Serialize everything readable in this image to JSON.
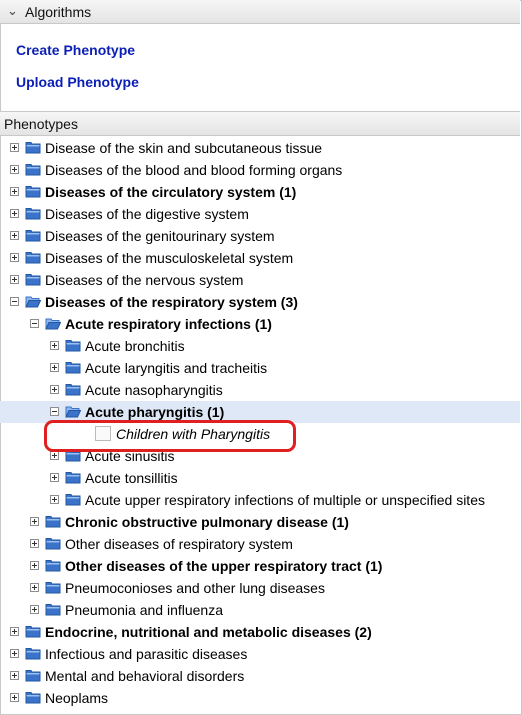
{
  "algorithms": {
    "title": "Algorithms",
    "links": [
      "Create Phenotype",
      "Upload Phenotype"
    ]
  },
  "phenotypes": {
    "title": "Phenotypes",
    "nodes": [
      {
        "label": "Disease of the skin and subcutaneous tissue",
        "level": 0,
        "state": "collapsed",
        "bold": false,
        "icon": "folder-icon"
      },
      {
        "label": "Diseases of the blood and blood forming organs",
        "level": 0,
        "state": "collapsed",
        "bold": false,
        "icon": "folder-icon"
      },
      {
        "label": "Diseases of the circulatory system (1)",
        "level": 0,
        "state": "collapsed",
        "bold": true,
        "icon": "folder-icon"
      },
      {
        "label": "Diseases of the digestive system",
        "level": 0,
        "state": "collapsed",
        "bold": false,
        "icon": "folder-icon"
      },
      {
        "label": "Diseases of the genitourinary system",
        "level": 0,
        "state": "collapsed",
        "bold": false,
        "icon": "folder-icon"
      },
      {
        "label": "Diseases of the musculoskeletal system",
        "level": 0,
        "state": "collapsed",
        "bold": false,
        "icon": "folder-icon"
      },
      {
        "label": "Diseases of the nervous system",
        "level": 0,
        "state": "collapsed",
        "bold": false,
        "icon": "folder-icon"
      },
      {
        "label": "Diseases of the respiratory system (3)",
        "level": 0,
        "state": "expanded",
        "bold": true,
        "icon": "folder-open-icon"
      },
      {
        "label": "Acute respiratory infections (1)",
        "level": 1,
        "state": "expanded",
        "bold": true,
        "icon": "folder-open-icon"
      },
      {
        "label": "Acute bronchitis",
        "level": 2,
        "state": "collapsed",
        "bold": false,
        "icon": "folder-icon"
      },
      {
        "label": "Acute laryngitis and tracheitis",
        "level": 2,
        "state": "collapsed",
        "bold": false,
        "icon": "folder-icon"
      },
      {
        "label": "Acute nasopharyngitis",
        "level": 2,
        "state": "collapsed",
        "bold": false,
        "icon": "folder-icon"
      },
      {
        "label": "Acute pharyngitis (1)",
        "level": 2,
        "state": "expanded",
        "bold": true,
        "icon": "folder-open-icon",
        "selected": true
      },
      {
        "label": "Children with Pharyngitis",
        "level": 3,
        "state": "leaf",
        "bold": false,
        "italic": true,
        "icon": "phenotype-leaf-icon",
        "highlighted": true
      },
      {
        "label": "Acute sinusitis",
        "level": 2,
        "state": "collapsed",
        "bold": false,
        "icon": "folder-icon"
      },
      {
        "label": "Acute tonsillitis",
        "level": 2,
        "state": "collapsed",
        "bold": false,
        "icon": "folder-icon"
      },
      {
        "label": "Acute upper respiratory infections of multiple or unspecified sites",
        "level": 2,
        "state": "collapsed",
        "bold": false,
        "icon": "folder-icon"
      },
      {
        "label": "Chronic obstructive pulmonary disease (1)",
        "level": 1,
        "state": "collapsed",
        "bold": true,
        "icon": "folder-icon"
      },
      {
        "label": "Other diseases of respiratory system",
        "level": 1,
        "state": "collapsed",
        "bold": false,
        "icon": "folder-icon"
      },
      {
        "label": "Other diseases of the upper respiratory tract (1)",
        "level": 1,
        "state": "collapsed",
        "bold": true,
        "icon": "folder-icon"
      },
      {
        "label": "Pneumoconioses and other lung diseases",
        "level": 1,
        "state": "collapsed",
        "bold": false,
        "icon": "folder-icon"
      },
      {
        "label": "Pneumonia and influenza",
        "level": 1,
        "state": "collapsed",
        "bold": false,
        "icon": "folder-icon"
      },
      {
        "label": "Endocrine, nutritional and metabolic diseases (2)",
        "level": 0,
        "state": "collapsed",
        "bold": true,
        "icon": "folder-icon"
      },
      {
        "label": "Infectious and parasitic diseases",
        "level": 0,
        "state": "collapsed",
        "bold": false,
        "icon": "folder-icon"
      },
      {
        "label": "Mental and behavioral disorders",
        "level": 0,
        "state": "collapsed",
        "bold": false,
        "icon": "folder-icon"
      },
      {
        "label": "Neoplams",
        "level": 0,
        "state": "collapsed",
        "bold": false,
        "icon": "folder-icon"
      }
    ]
  },
  "colors": {
    "link": "#0b1fb5",
    "selection": "#dfe8f6",
    "highlight_ring": "#e02020",
    "folder": "#3a73c9"
  }
}
